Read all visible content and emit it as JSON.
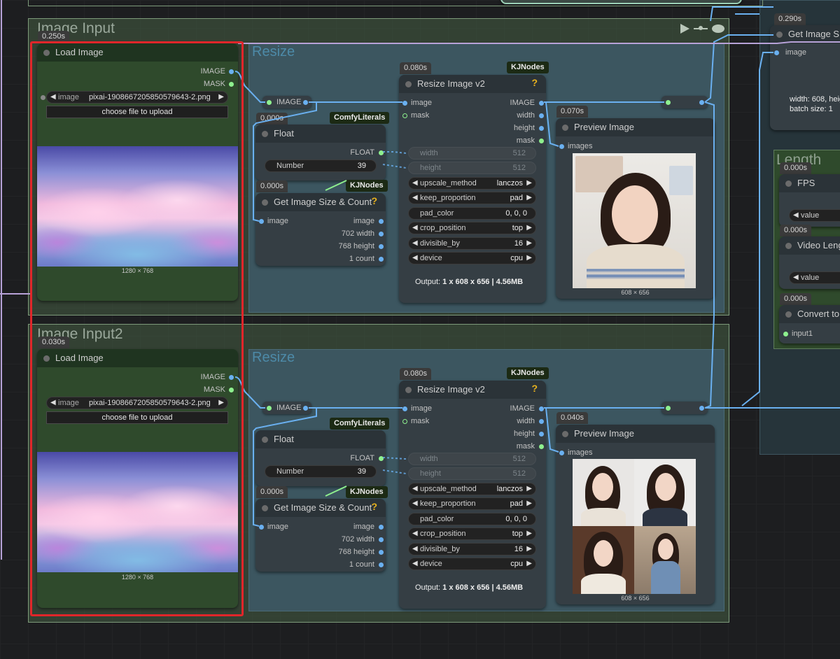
{
  "colors": {
    "highlight": "#e0262a",
    "wire_image": "#6ab0f0",
    "wire_float": "#8ef08e",
    "group_border": "#7d9a7a"
  },
  "icons": {
    "run": "play-icon",
    "bypass": "route-icon",
    "mute": "eye-icon"
  },
  "groups": [
    {
      "title": "Image Input",
      "subgroup_title": "Resize",
      "load": {
        "time": "0.250s",
        "title": "Load Image",
        "out_image": "IMAGE",
        "out_mask": "MASK",
        "image_label": "image",
        "image_value": "pixai-1908667205850579643-2.png",
        "upload": "choose file to upload",
        "caption": "1280 × 768"
      },
      "reroute_label": "IMAGE",
      "float": {
        "time": "0.000s",
        "tag": "ComfyLiterals",
        "title": "Float",
        "out": "FLOAT",
        "number_label": "Number",
        "number_value": "39"
      },
      "getsize": {
        "time": "0.000s",
        "tag": "KJNodes",
        "title": "Get Image Size & Count",
        "in": "image",
        "out_image": "image",
        "out_width": "702 width",
        "out_height": "768 height",
        "out_count": "1 count",
        "help": "?"
      },
      "resize": {
        "time": "0.080s",
        "tag": "KJNodes",
        "title": "Resize Image v2",
        "help": "?",
        "in_image": "image",
        "in_mask": "mask",
        "out_image": "IMAGE",
        "out_width": "width",
        "out_height": "height",
        "out_mask": "mask",
        "widgets": [
          {
            "label": "width",
            "value": "512",
            "kind": "disabled"
          },
          {
            "label": "height",
            "value": "512",
            "kind": "disabled"
          },
          {
            "label": "upscale_method",
            "value": "lanczos",
            "kind": "combo"
          },
          {
            "label": "keep_proportion",
            "value": "pad",
            "kind": "combo"
          },
          {
            "label": "pad_color",
            "value": "0, 0, 0",
            "kind": "text"
          },
          {
            "label": "crop_position",
            "value": "top",
            "kind": "combo"
          },
          {
            "label": "divisible_by",
            "value": "16",
            "kind": "combo"
          },
          {
            "label": "device",
            "value": "cpu",
            "kind": "combo"
          }
        ],
        "output_prefix": "Output:",
        "output_value": "1 x 608 x 656 | 4.56MB"
      },
      "preview": {
        "time": "0.070s",
        "title": "Preview Image",
        "in": "images",
        "caption": "608 × 656"
      }
    },
    {
      "title": "Image Input2",
      "subgroup_title": "Resize",
      "load": {
        "time": "0.030s",
        "title": "Load Image",
        "out_image": "IMAGE",
        "out_mask": "MASK",
        "image_label": "image",
        "image_value": "pixai-1908667205850579643-2.png",
        "upload": "choose file to upload",
        "caption": "1280 × 768"
      },
      "reroute_label": "IMAGE",
      "float": {
        "time": "",
        "tag": "ComfyLiterals",
        "title": "Float",
        "out": "FLOAT",
        "number_label": "Number",
        "number_value": "39"
      },
      "getsize": {
        "time": "0.000s",
        "tag": "KJNodes",
        "title": "Get Image Size & Count",
        "in": "image",
        "out_image": "image",
        "out_width": "702 width",
        "out_height": "768 height",
        "out_count": "1 count",
        "help": "?"
      },
      "resize": {
        "time": "0.080s",
        "tag": "KJNodes",
        "title": "Resize Image v2",
        "help": "?",
        "in_image": "image",
        "in_mask": "mask",
        "out_image": "IMAGE",
        "out_width": "width",
        "out_height": "height",
        "out_mask": "mask",
        "widgets": [
          {
            "label": "width",
            "value": "512",
            "kind": "disabled"
          },
          {
            "label": "height",
            "value": "512",
            "kind": "disabled"
          },
          {
            "label": "upscale_method",
            "value": "lanczos",
            "kind": "combo"
          },
          {
            "label": "keep_proportion",
            "value": "pad",
            "kind": "combo"
          },
          {
            "label": "pad_color",
            "value": "0, 0, 0",
            "kind": "text"
          },
          {
            "label": "crop_position",
            "value": "top",
            "kind": "combo"
          },
          {
            "label": "divisible_by",
            "value": "16",
            "kind": "combo"
          },
          {
            "label": "device",
            "value": "cpu",
            "kind": "combo"
          }
        ],
        "output_prefix": "Output:",
        "output_value": "1 x 608 x 656 | 4.56MB"
      },
      "preview": {
        "time": "0.040s",
        "title": "Preview Image",
        "in": "images",
        "caption": "608 × 656"
      }
    }
  ],
  "right": {
    "getsize_time": "0.290s",
    "getsize_title": "Get Image S",
    "getsize_in": "image",
    "info_line1": "width: 608, heig",
    "info_line2": "batch size: 1",
    "length_title": "Length",
    "fps_time": "0.000s",
    "fps_title": "FPS",
    "fps_widget": "value",
    "vlen_time": "0.000s",
    "vlen_title": "Video Leng",
    "vlen_widget": "value",
    "conv_time": "0.000s",
    "conv_title": "Convert to",
    "conv_in": "input1"
  }
}
